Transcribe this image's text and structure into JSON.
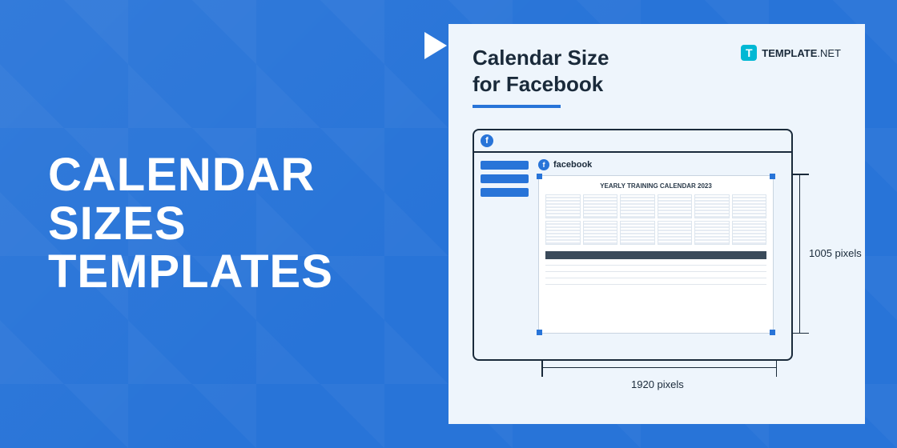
{
  "headline": {
    "line1": "CALENDAR",
    "line2": "SIZES",
    "line3": "TEMPLATES"
  },
  "card": {
    "title_line1": "Calendar Size",
    "title_line2": "for Facebook",
    "brand_letter": "T",
    "brand_name": "TEMPLATE",
    "brand_suffix": ".NET"
  },
  "mockup": {
    "fb_letter": "f",
    "fb_name": "facebook",
    "post_title": "YEARLY TRAINING CALENDAR 2023"
  },
  "dimensions": {
    "height": "1005 pixels",
    "width": "1920 pixels"
  }
}
